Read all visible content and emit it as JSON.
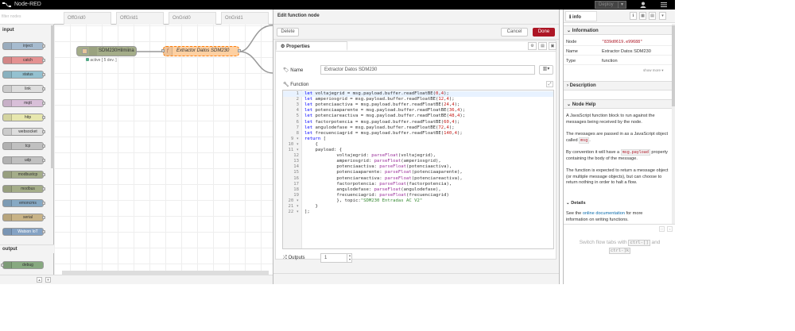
{
  "header": {
    "title": "Node-RED",
    "deploy_label": "Deploy"
  },
  "palette": {
    "filter_placeholder": "filter nodes",
    "categories": [
      "input",
      "output"
    ],
    "input_nodes": [
      "inject",
      "catch",
      "status",
      "link",
      "mqtt",
      "http",
      "websocket",
      "tcp",
      "udp",
      "modbustcp",
      "modbus",
      "emoncms",
      "serial",
      "Watson IoT"
    ],
    "output_nodes": [
      "debug"
    ]
  },
  "workspace": {
    "tabs": [
      "OffGrid0",
      "OffGrid1",
      "OnGrid0",
      "OnGrid1"
    ],
    "nodes": {
      "source_label": "SDM230Hilmiina",
      "source_status": "active [ 5 dev. ]",
      "function_label": "Extractor Datos SDM230"
    }
  },
  "editor": {
    "title": "Edit function node",
    "delete_label": "Delete",
    "cancel_label": "Cancel",
    "done_label": "Done",
    "properties_tab": "Properties",
    "name_label": "Name",
    "name_value": "Extractor Datos SDM230",
    "function_label": "Function",
    "outputs_label": "Outputs",
    "outputs_value": "1",
    "code_lines": [
      [
        "1",
        "let voltajegrid = msg.payload.buffer.readFloatBE(0,4);"
      ],
      [
        "2",
        "let amperiosgrid = msg.payload.buffer.readFloatBE(12,4);"
      ],
      [
        "3",
        "let potenciaactiva = msg.payload.buffer.readFloatBE(24,4);"
      ],
      [
        "4",
        "let potenciaaparente = msg.payload.buffer.readFloatBE(36,4);"
      ],
      [
        "5",
        "let potenciareactiva = msg.payload.buffer.readFloatBE(48,4);"
      ],
      [
        "6",
        "let factorpotencia = msg.payload.buffer.readFloatBE(60,4);"
      ],
      [
        "7",
        "let angulodefase = msg.payload.buffer.readFloatBE(72,4);"
      ],
      [
        "8",
        "let frecuenciagrid = msg.payload.buffer.readFloatBE(140,4);"
      ],
      [
        "9 ▾",
        "return ["
      ],
      [
        "10 ▾",
        "    {"
      ],
      [
        "11 ▾",
        "    payload: {"
      ],
      [
        "12",
        "            voltajegrid: parseFloat(voltajegrid),"
      ],
      [
        "13",
        "            amperiosgrid: parseFloat(amperiosgrid),"
      ],
      [
        "14",
        "            potenciaactiva: parseFloat(potenciaactiva),"
      ],
      [
        "15",
        "            potenciaaparente: parseFloat(potenciaaparente),"
      ],
      [
        "16",
        "            potenciareactiva: parseFloat(potenciareactiva),"
      ],
      [
        "17",
        "            factorpotencia: parseFloat(factorpotencia),"
      ],
      [
        "18",
        "            angulodefase: parseFloat(angulodefase),"
      ],
      [
        "19",
        "            frecuenciagrid: parseFloat(frecuenciagrid)"
      ],
      [
        "20 ▾",
        "            }, topic:\"SDM230 Entradas AC V2\""
      ],
      [
        "21 ▾",
        "    }"
      ],
      [
        "22 ▾",
        "];"
      ]
    ]
  },
  "sidebar": {
    "tab_label": "info",
    "info_section": "Information",
    "rows": [
      {
        "key": "Node",
        "value": "\"839d0619.e99688\""
      },
      {
        "key": "Name",
        "value": "Extractor Datos SDM230"
      },
      {
        "key": "Type",
        "value": "function"
      }
    ],
    "show_more": "show more ▾",
    "description_section": "Description",
    "help_section": "Node Help",
    "help_p1": "A JavaScript function block to run against the messages being received by the node.",
    "help_p2a": "The messages are passed in as a JavaScript object called ",
    "help_p2code": "msg",
    "help_p2b": ".",
    "help_p3a": "By convention it will have a ",
    "help_p3code": "msg.payload",
    "help_p3b": " property containing the body of the message.",
    "help_p4": "The function is expected to return a message object (or multiple message objects), but can choose to return nothing in order to halt a flow.",
    "details_label": "Details",
    "help_p5a": "See the ",
    "help_p5link": "online documentation",
    "help_p5b": " for more",
    "help_p6": "information on writing functions.",
    "hint_a": "Switch flow tabs with ",
    "hint_k1": "ctrl-[]",
    "hint_and": " and",
    "hint_k2": "ctrl-]k"
  }
}
